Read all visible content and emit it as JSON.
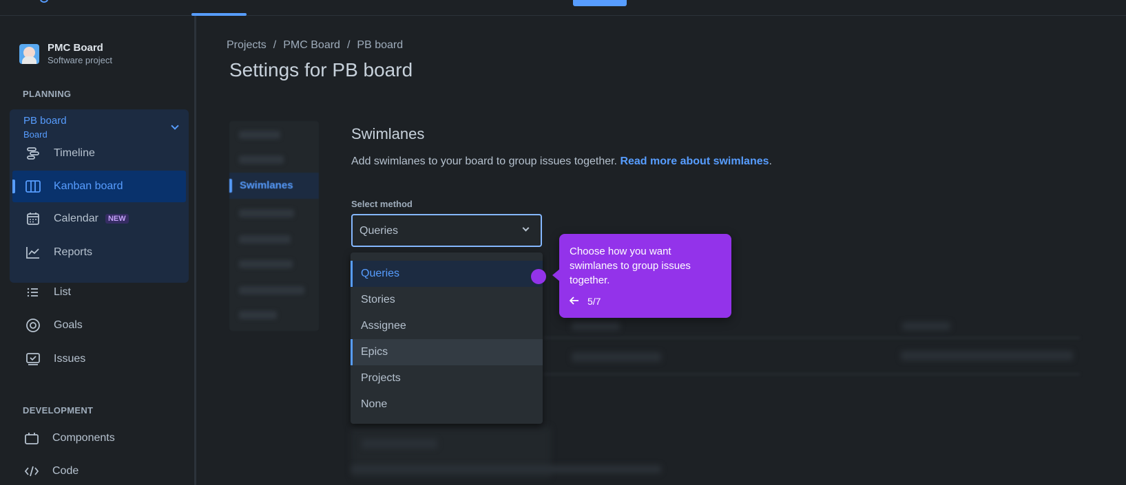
{
  "project": {
    "name": "PMC Board",
    "type": "Software project"
  },
  "sidebar": {
    "planning_label": "PLANNING",
    "board": {
      "name": "PB board",
      "type": "Board"
    },
    "planning_items": [
      {
        "label": "Timeline",
        "icon": "timeline-icon"
      },
      {
        "label": "Kanban board",
        "icon": "kanban-icon"
      },
      {
        "label": "Calendar",
        "icon": "calendar-icon",
        "badge": "NEW"
      },
      {
        "label": "Reports",
        "icon": "reports-icon"
      }
    ],
    "other_items": [
      {
        "label": "List",
        "icon": "list-icon"
      },
      {
        "label": "Goals",
        "icon": "goals-icon"
      },
      {
        "label": "Issues",
        "icon": "issues-icon"
      }
    ],
    "development_label": "DEVELOPMENT",
    "dev_items": [
      {
        "label": "Components",
        "icon": "components-icon"
      },
      {
        "label": "Code",
        "icon": "code-icon"
      }
    ]
  },
  "breadcrumb": [
    "Projects",
    "PMC Board",
    "PB board"
  ],
  "page_title": "Settings for PB board",
  "subnav": {
    "selected": "Swimlanes"
  },
  "swimlanes": {
    "title": "Swimlanes",
    "description": "Add swimlanes to your board to group issues together. ",
    "link": "Read more about swimlanes",
    "link_suffix": ".",
    "select_label": "Select method",
    "select_value": "Queries",
    "options": [
      "Queries",
      "Stories",
      "Assignee",
      "Epics",
      "Projects",
      "None"
    ]
  },
  "tooltip": {
    "text": "Choose how you want swimlanes to group issues together.",
    "step": "5/7"
  },
  "colors": {
    "accent": "#579dff",
    "tooltip": "#9333ea",
    "background": "#1d2125"
  }
}
